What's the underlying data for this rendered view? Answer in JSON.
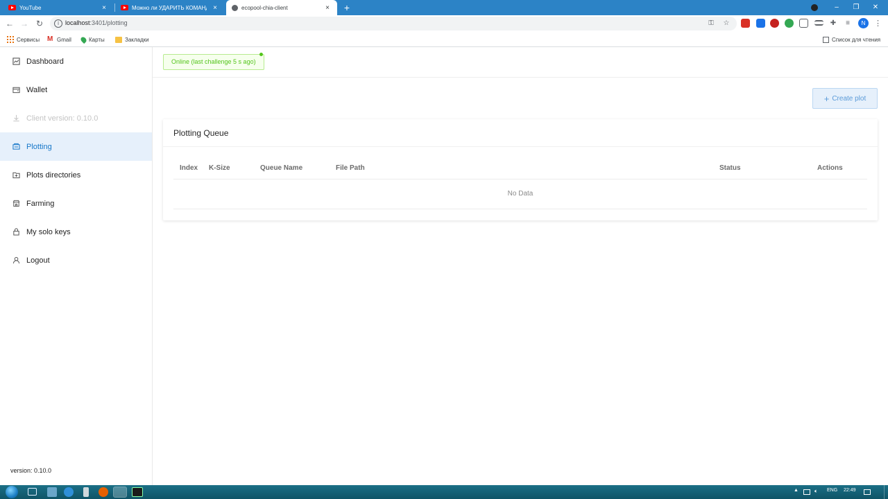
{
  "browser": {
    "tabs": [
      {
        "title": "YouTube",
        "icon": "youtube-icon",
        "active": false
      },
      {
        "title": "Можно ли УДАРИТЬ КОМАНДИ",
        "icon": "youtube-icon",
        "active": false
      },
      {
        "title": "ecopool-chia-client",
        "icon": "globe-icon",
        "active": true
      }
    ],
    "close_glyph": "×",
    "new_tab_glyph": "+",
    "window_controls": {
      "minimize": "–",
      "maximize": "❐",
      "close": "✕"
    },
    "url_host": "localhost",
    "url_rest": ":3401/plotting",
    "profile_initial": "N",
    "bookmarks": [
      {
        "label": "Сервисы",
        "icon": "apps-grid-icon"
      },
      {
        "label": "Gmail",
        "icon": "gmail-icon"
      },
      {
        "label": "Карты",
        "icon": "maps-pin-icon"
      },
      {
        "label": "Закладки",
        "icon": "folder-icon"
      }
    ],
    "reading_list": "Список для чтения"
  },
  "sidebar": {
    "items": [
      {
        "label": "Dashboard",
        "icon": "dashboard-icon",
        "state": "normal"
      },
      {
        "label": "Wallet",
        "icon": "wallet-icon",
        "state": "normal"
      },
      {
        "label": "Client version: 0.10.0",
        "icon": "download-icon",
        "state": "disabled"
      },
      {
        "label": "Plotting",
        "icon": "plotting-icon",
        "state": "active"
      },
      {
        "label": "Plots directories",
        "icon": "folder-add-icon",
        "state": "normal"
      },
      {
        "label": "Farming",
        "icon": "shop-icon",
        "state": "normal"
      },
      {
        "label": "My solo keys",
        "icon": "lock-icon",
        "state": "normal"
      },
      {
        "label": "Logout",
        "icon": "user-icon",
        "state": "normal"
      }
    ],
    "version": "version: 0.10.0"
  },
  "status": {
    "online_text": "Online (last challenge 5 s ago)"
  },
  "actions": {
    "create_plot": "Create plot",
    "plus_glyph": "+"
  },
  "queue": {
    "title": "Plotting Queue",
    "columns": {
      "index": "Index",
      "ksize": "K-Size",
      "queue_name": "Queue Name",
      "file_path": "File Path",
      "status": "Status",
      "actions": "Actions"
    },
    "empty_text": "No Data"
  },
  "taskbar": {
    "language": "ENG",
    "time": "22:49"
  },
  "colors": {
    "tabstrip": "#2c83c6",
    "active_nav_bg": "#e6f0fb",
    "active_nav_text": "#1677c9",
    "online_green": "#52c41a"
  }
}
